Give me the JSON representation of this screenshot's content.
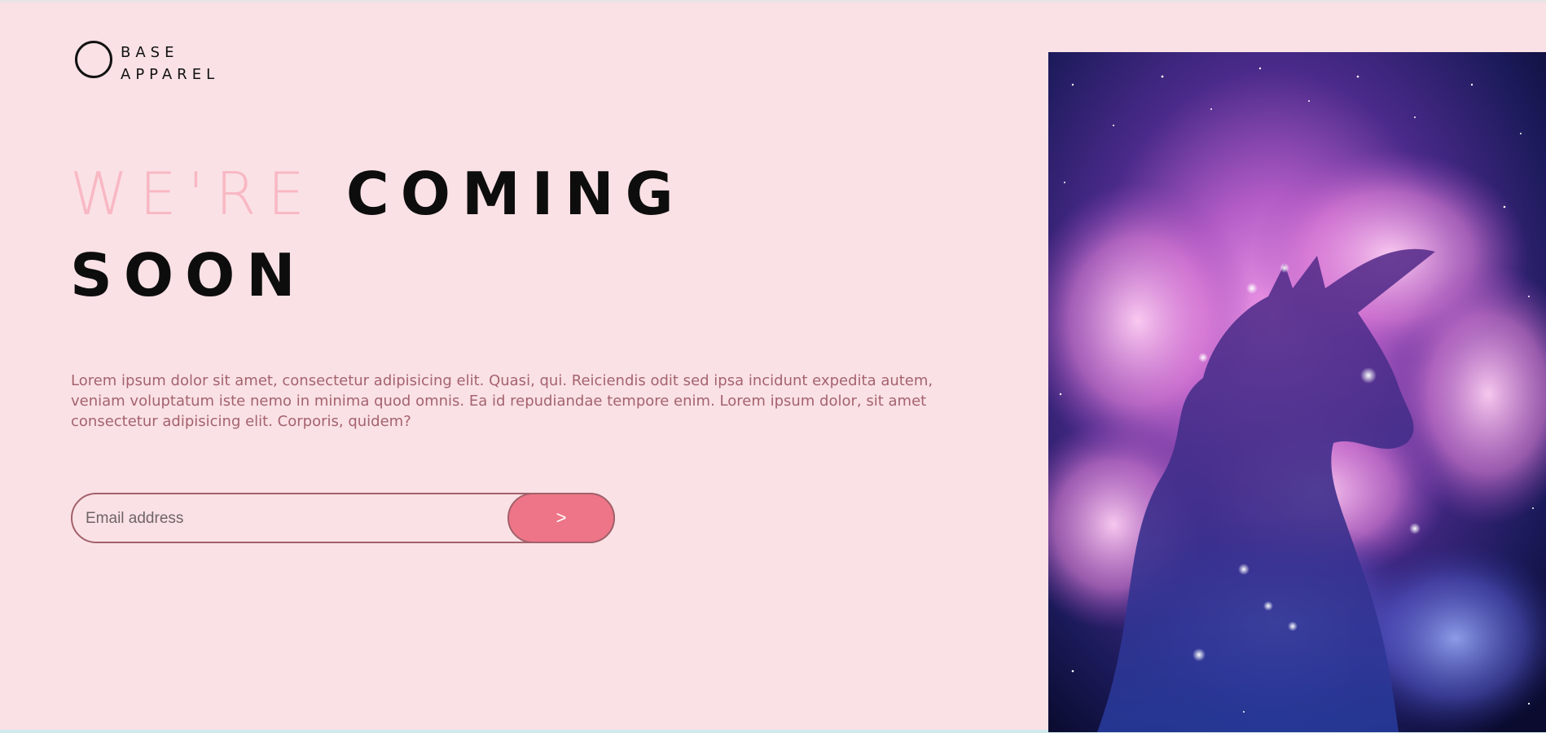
{
  "brand": {
    "line1": "BASE",
    "line2": "APPAREL"
  },
  "hero": {
    "title_light": "WE'RE",
    "title_bold_1": "COMING",
    "title_bold_2": "SOON",
    "description": "Lorem ipsum dolor sit amet, consectetur adipisicing elit. Quasi, qui. Reiciendis odit sed ipsa incidunt expedita autem, veniam voluptatum iste nemo in minima quod omnis. Ea id repudiandae tempore enim. Lorem ipsum dolor, sit amet consectetur adipisicing elit. Corporis, quidem?"
  },
  "form": {
    "email_placeholder": "Email address",
    "submit_label": ">"
  },
  "colors": {
    "background": "#fae1e5",
    "accent": "#ee7587",
    "text_muted": "#a4636e",
    "title_light": "#f8b8c3"
  }
}
